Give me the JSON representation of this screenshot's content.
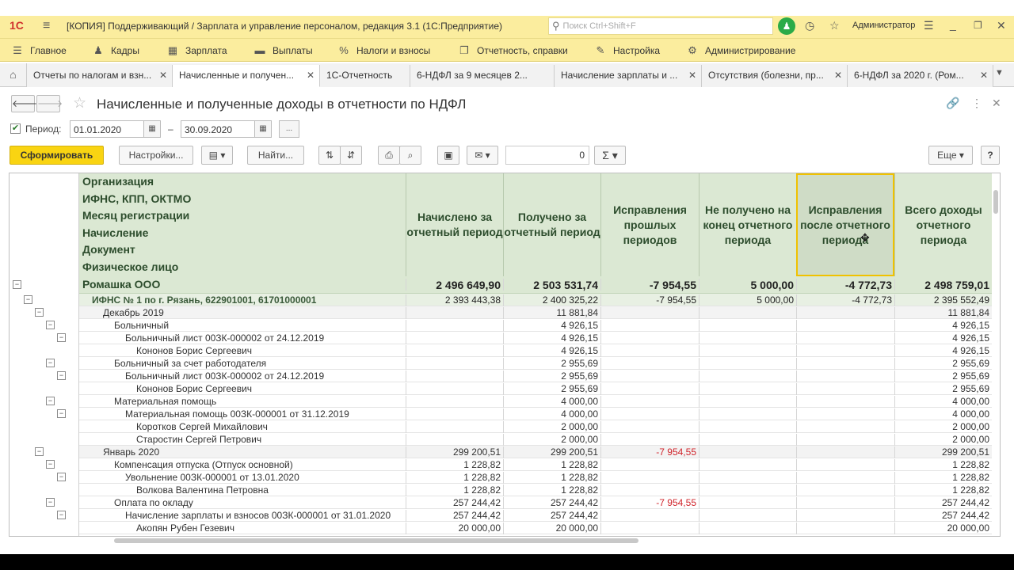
{
  "window": {
    "title": "[КОПИЯ] Поддерживающий / Зарплата и управление персоналом, редакция 3.1  (1С:Предприятие)",
    "logo": "1С",
    "search_placeholder": "Поиск Ctrl+Shift+F",
    "user": "Администратор"
  },
  "sections": [
    "Главное",
    "Кадры",
    "Зарплата",
    "Выплаты",
    "Налоги и взносы",
    "Отчетность, справки",
    "Настройка",
    "Администрирование"
  ],
  "tabs": [
    "Отчеты по налогам и взн...",
    "Начисленные и получен...",
    "1С-Отчетность",
    "6-НДФЛ за 9 месяцев 2...",
    "Начисление зарплаты и ...",
    "Отсутствия (болезни, пр...",
    "6-НДФЛ за 2020 г. (Ром..."
  ],
  "form": {
    "title": "Начисленные и полученные доходы в отчетности по НДФЛ",
    "period_label": "Период:",
    "date_from": "01.01.2020",
    "date_to": "30.09.2020",
    "dash": "–",
    "ellipsis": "..."
  },
  "toolbar": {
    "generate": "Сформировать",
    "settings": "Настройки...",
    "find": "Найти...",
    "number_value": "0",
    "more": "Еще",
    "help": "?"
  },
  "report": {
    "grouping_headers": [
      "Организация",
      "ИФНС, КПП, ОКТМО",
      "Месяц регистрации",
      "Начисление",
      "Документ",
      "Физическое лицо"
    ],
    "column_headers": [
      "Начислено за отчетный период",
      "Получено за отчетный период",
      "Исправления прошлых периодов",
      "Не получено на конец отчетного периода",
      "Исправления после отчетного периода",
      "Всего доходы отчетного периода"
    ],
    "rows": [
      {
        "label": "Ромашка ООО",
        "level": 0,
        "values": [
          "2 496 649,90",
          "2 503 531,74",
          "-7 954,55",
          "5 000,00",
          "-4 772,73",
          "2 498 759,01"
        ]
      },
      {
        "label": "ИФНС № 1 по г. Рязань, 622901001, 61701000001",
        "level": 1,
        "values": [
          "2 393 443,38",
          "2 400 325,22",
          "-7 954,55",
          "5 000,00",
          "-4 772,73",
          "2 395 552,49"
        ]
      },
      {
        "label": "Декабрь 2019",
        "level": 2,
        "values": [
          "",
          "11 881,84",
          "",
          "",
          "",
          "11 881,84"
        ]
      },
      {
        "label": "Больничный",
        "level": 3,
        "values": [
          "",
          "4 926,15",
          "",
          "",
          "",
          "4 926,15"
        ]
      },
      {
        "label": "Больничный лист 00ЗК-000002 от 24.12.2019",
        "level": 4,
        "values": [
          "",
          "4 926,15",
          "",
          "",
          "",
          "4 926,15"
        ]
      },
      {
        "label": "Кононов Борис Сергеевич",
        "level": 5,
        "values": [
          "",
          "4 926,15",
          "",
          "",
          "",
          "4 926,15"
        ]
      },
      {
        "label": "Больничный за счет работодателя",
        "level": 3,
        "values": [
          "",
          "2 955,69",
          "",
          "",
          "",
          "2 955,69"
        ]
      },
      {
        "label": "Больничный лист 00ЗК-000002 от 24.12.2019",
        "level": 4,
        "values": [
          "",
          "2 955,69",
          "",
          "",
          "",
          "2 955,69"
        ]
      },
      {
        "label": "Кононов Борис Сергеевич",
        "level": 5,
        "values": [
          "",
          "2 955,69",
          "",
          "",
          "",
          "2 955,69"
        ]
      },
      {
        "label": "Материальная помощь",
        "level": 3,
        "values": [
          "",
          "4 000,00",
          "",
          "",
          "",
          "4 000,00"
        ]
      },
      {
        "label": "Материальная помощь 00ЗК-000001 от 31.12.2019",
        "level": 4,
        "values": [
          "",
          "4 000,00",
          "",
          "",
          "",
          "4 000,00"
        ]
      },
      {
        "label": "Коротков Сергей Михайлович",
        "level": 5,
        "values": [
          "",
          "2 000,00",
          "",
          "",
          "",
          "2 000,00"
        ]
      },
      {
        "label": "Старостин Сергей Петрович",
        "level": 5,
        "values": [
          "",
          "2 000,00",
          "",
          "",
          "",
          "2 000,00"
        ]
      },
      {
        "label": "Январь 2020",
        "level": 2,
        "values": [
          "299 200,51",
          "299 200,51",
          "-7 954,55",
          "",
          "",
          "299 200,51"
        ]
      },
      {
        "label": "Компенсация отпуска (Отпуск основной)",
        "level": 3,
        "values": [
          "1 228,82",
          "1 228,82",
          "",
          "",
          "",
          "1 228,82"
        ]
      },
      {
        "label": "Увольнение 00ЗК-000001 от 13.01.2020",
        "level": 4,
        "values": [
          "1 228,82",
          "1 228,82",
          "",
          "",
          "",
          "1 228,82"
        ]
      },
      {
        "label": "Волкова Валентина Петровна",
        "level": 5,
        "values": [
          "1 228,82",
          "1 228,82",
          "",
          "",
          "",
          "1 228,82"
        ]
      },
      {
        "label": "Оплата по окладу",
        "level": 3,
        "values": [
          "257 244,42",
          "257 244,42",
          "-7 954,55",
          "",
          "",
          "257 244,42"
        ]
      },
      {
        "label": "Начисление зарплаты и взносов 00ЗК-000001 от 31.01.2020",
        "level": 4,
        "values": [
          "257 244,42",
          "257 244,42",
          "",
          "",
          "",
          "257 244,42"
        ]
      },
      {
        "label": "Акопян Рубен Гезевич",
        "level": 5,
        "values": [
          "20 000,00",
          "20 000,00",
          "",
          "",
          "",
          "20 000,00"
        ]
      }
    ]
  },
  "colors": {
    "section_bar": "#fbed9e",
    "generate_button": "#f9d412",
    "header_bg": "#dbe8d3",
    "negative": "#d0242b"
  }
}
